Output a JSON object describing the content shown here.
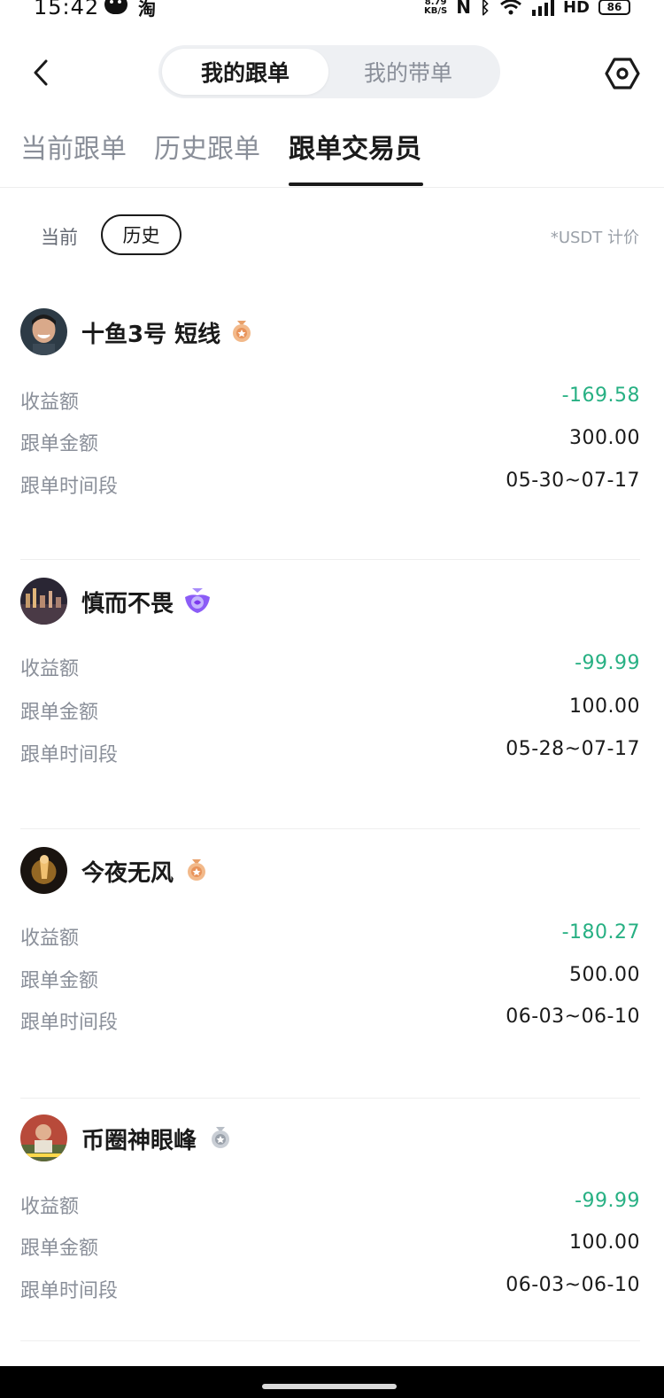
{
  "status_bar": {
    "time": "15:42",
    "net_speed_value": "8.79",
    "net_speed_unit": "KB/S",
    "hd_label": "HD",
    "battery": "86",
    "taobao": "淘"
  },
  "header": {
    "segments": [
      "我的跟单",
      "我的带单"
    ],
    "active_segment": "我的跟单"
  },
  "tabs": {
    "items": [
      "当前跟单",
      "历史跟单",
      "跟单交易员"
    ],
    "active": "跟单交易员"
  },
  "filter": {
    "current": "当前",
    "history": "历史",
    "active": "历史",
    "unit_note": "*USDT 计价"
  },
  "labels": {
    "profit": "收益额",
    "amount": "跟单金额",
    "period": "跟单时间段"
  },
  "traders": [
    {
      "name": "十鱼3号 短线",
      "medal": "bronze",
      "profit": "-169.58",
      "amount": "300.00",
      "period": "05-30~07-17"
    },
    {
      "name": "慎而不畏",
      "medal": "purple",
      "profit": "-99.99",
      "amount": "100.00",
      "period": "05-28~07-17"
    },
    {
      "name": "今夜无风",
      "medal": "bronze",
      "profit": "-180.27",
      "amount": "500.00",
      "period": "06-03~06-10"
    },
    {
      "name": "币圈神眼峰",
      "medal": "silver",
      "profit": "-99.99",
      "amount": "100.00",
      "period": "06-03~06-10"
    }
  ],
  "colors": {
    "negative": "#27b083",
    "text_primary": "#1a1a1a",
    "text_secondary": "#8a8f99",
    "medal_bronze": "#e8a06a",
    "medal_purple": "#8b5cf6",
    "medal_silver": "#a7adb5"
  }
}
